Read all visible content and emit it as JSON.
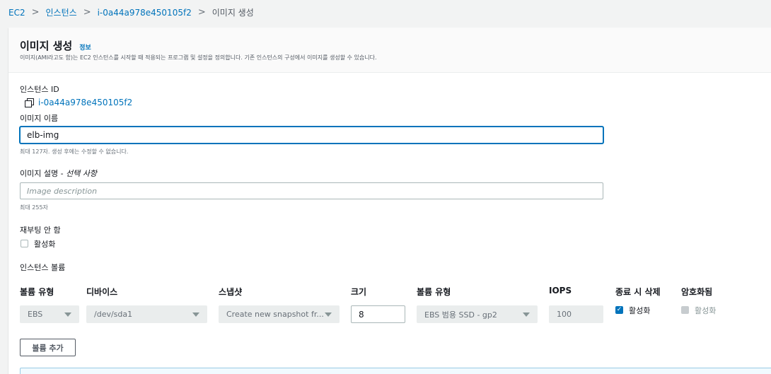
{
  "breadcrumb": {
    "ec2": "EC2",
    "instances": "인스턴스",
    "instance_id": "i-0a44a978e450105f2",
    "current": "이미지 생성"
  },
  "header": {
    "title": "이미지 생성",
    "info": "정보",
    "description": "이미지(AMI라고도 함)는 EC2 인스턴스를 시작할 때 적용되는 프로그램 및 설정을 정의합니다. 기존 인스턴스의 구성에서 이미지를 생성할 수 있습니다."
  },
  "instance": {
    "label": "인스턴스 ID",
    "id": "i-0a44a978e450105f2"
  },
  "image_name": {
    "label": "이미지 이름",
    "value": "elb-img",
    "hint": "최대 127자. 생성 후에는 수정할 수 없습니다."
  },
  "image_description": {
    "label": "이미지 설명",
    "optional": "선택 사항",
    "placeholder": "Image description",
    "hint": "최대 255자"
  },
  "no_reboot": {
    "label": "재부팅 안 함",
    "checkbox_label": "활성화"
  },
  "volumes": {
    "section_label": "인스턴스 볼륨",
    "columns": [
      "볼륨 유형",
      "디바이스",
      "스냅샷",
      "크기",
      "볼륨 유형",
      "IOPS",
      "종료 시 삭제",
      "암호화됨"
    ],
    "row": {
      "volume_type": "EBS",
      "device": "/dev/sda1",
      "snapshot": "Create new snapshot fr...",
      "size": "8",
      "ebs_type": "EBS 범용 SSD - gp2",
      "iops": "100",
      "delete_on_termination": "활성화",
      "encrypted": "활성화"
    },
    "add_button": "볼륨 추가"
  },
  "colors": {
    "link": "#0073bb",
    "checkbox_on": "#0073bb"
  }
}
